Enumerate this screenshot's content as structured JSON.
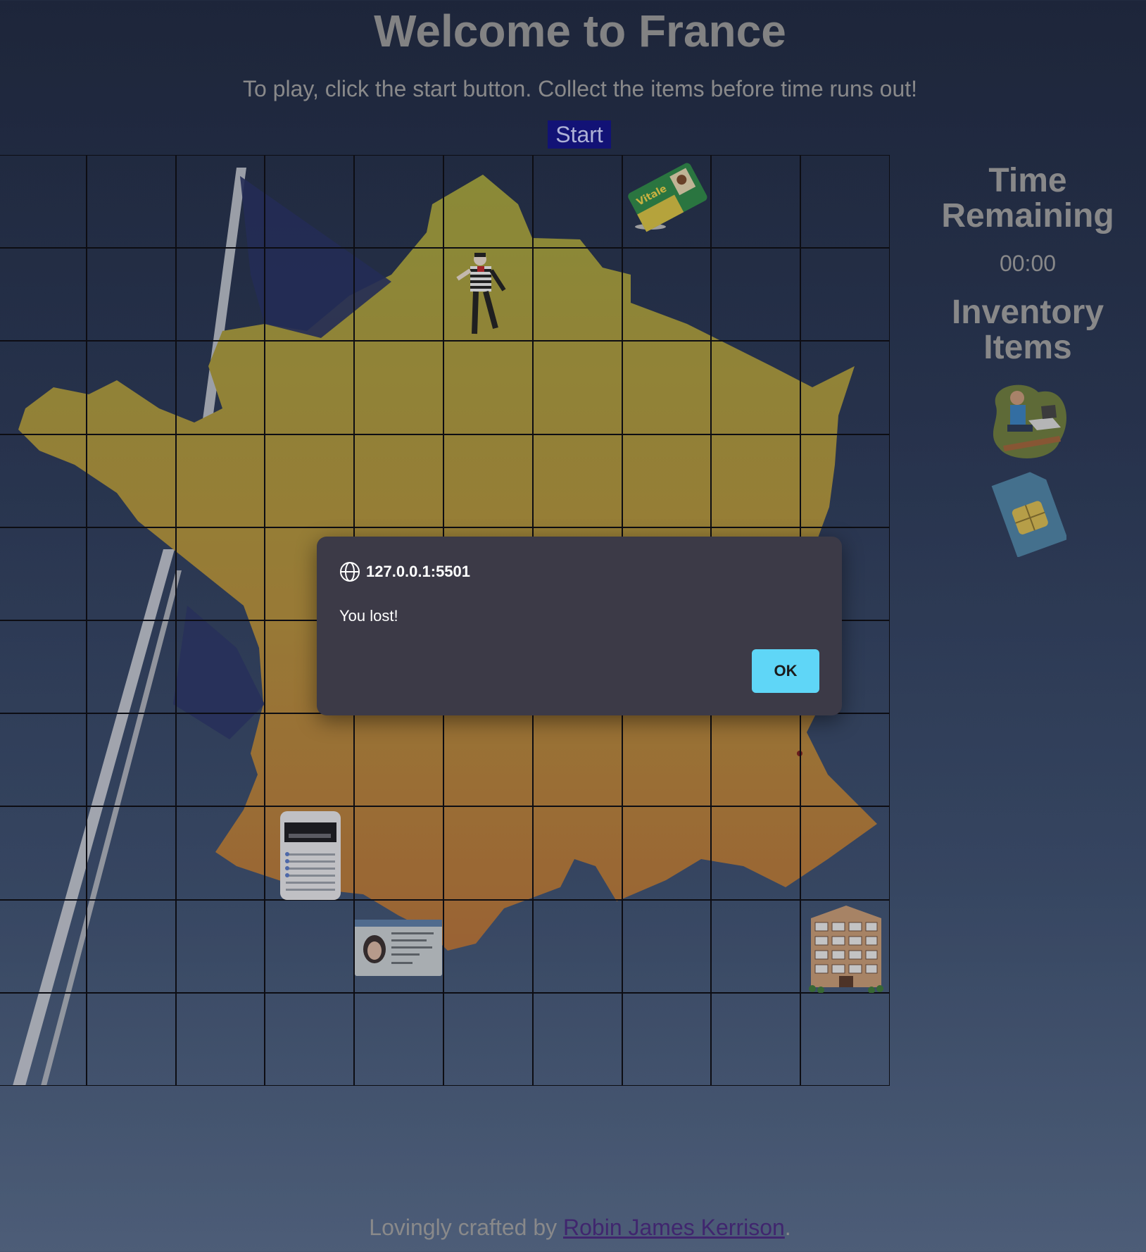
{
  "header": {
    "title": "Welcome to France",
    "subtitle": "To play, click the start button. Collect the items before time runs out!",
    "start_label": "Start"
  },
  "board": {
    "rows": 10,
    "columns": 10,
    "items": [
      {
        "name": "carte-vitale-card-icon",
        "row": 0,
        "col": 7
      },
      {
        "name": "mime-character-icon",
        "row": 1,
        "col": 5
      },
      {
        "name": "banking-app-phone-icon",
        "row": 7,
        "col": 3
      },
      {
        "name": "identity-card-icon",
        "row": 8,
        "col": 4
      },
      {
        "name": "apartment-building-icon",
        "row": 8,
        "col": 9
      }
    ]
  },
  "sidebar": {
    "time_heading": "Time Remaining",
    "time_value": "00:00",
    "inventory_heading": "Inventory Items",
    "inventory": [
      "remote-worker-icon",
      "sim-card-icon"
    ]
  },
  "dialog": {
    "host": "127.0.0.1:5501",
    "message": "You lost!",
    "ok_label": "OK"
  },
  "footer": {
    "prefix": "Lovingly crafted by ",
    "author": "Robin James Kerrison",
    "suffix": "."
  },
  "colors": {
    "map_top": "#a4a43e",
    "map_bottom": "#b8743a",
    "start_bg": "#12128a",
    "ok_bg": "#5fd6f7",
    "dialog_bg": "#3c3a47"
  }
}
